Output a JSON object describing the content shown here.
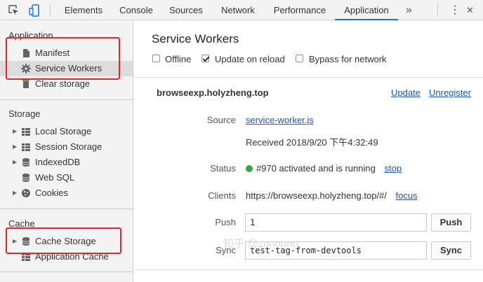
{
  "tabs": [
    {
      "label": "Elements"
    },
    {
      "label": "Console"
    },
    {
      "label": "Sources"
    },
    {
      "label": "Network"
    },
    {
      "label": "Performance"
    },
    {
      "label": "Application"
    }
  ],
  "toolbar": {
    "more_tabs": "»",
    "kebab": "⋮",
    "close": "✕"
  },
  "sidebar": {
    "application_title": "Application",
    "application_items": [
      {
        "label": "Manifest"
      },
      {
        "label": "Service Workers"
      },
      {
        "label": "Clear storage"
      }
    ],
    "storage_title": "Storage",
    "storage_items": [
      {
        "label": "Local Storage"
      },
      {
        "label": "Session Storage"
      },
      {
        "label": "IndexedDB"
      },
      {
        "label": "Web SQL"
      },
      {
        "label": "Cookies"
      }
    ],
    "cache_title": "Cache",
    "cache_items": [
      {
        "label": "Cache Storage"
      },
      {
        "label": "Application Cache"
      }
    ]
  },
  "main": {
    "title": "Service Workers",
    "options": {
      "offline": {
        "label": "Offline",
        "checked": false
      },
      "update_on_reload": {
        "label": "Update on reload",
        "checked": true
      },
      "bypass": {
        "label": "Bypass for network",
        "checked": false
      }
    },
    "worker": {
      "host": "browseexp.holyzheng.top",
      "update_link": "Update",
      "unregister_link": "Unregister",
      "source_label": "Source",
      "source_link": "service-worker.js",
      "received": "Received 2018/9/20 下午4:32:49",
      "status_label": "Status",
      "status_text": "#970 activated and is running",
      "status_color": "#36a544",
      "stop_link": "stop",
      "clients_label": "Clients",
      "clients_url": "https://browseexp.holyzheng.top/#/",
      "focus_link": "focus",
      "push_label": "Push",
      "push_value": "1",
      "push_button": "Push",
      "sync_label": "Sync",
      "sync_value": "test-tag-from-devtools",
      "sync_button": "Sync"
    }
  },
  "watermark": "知乎 @znnnnnn",
  "highlight_color": "#e4252b"
}
